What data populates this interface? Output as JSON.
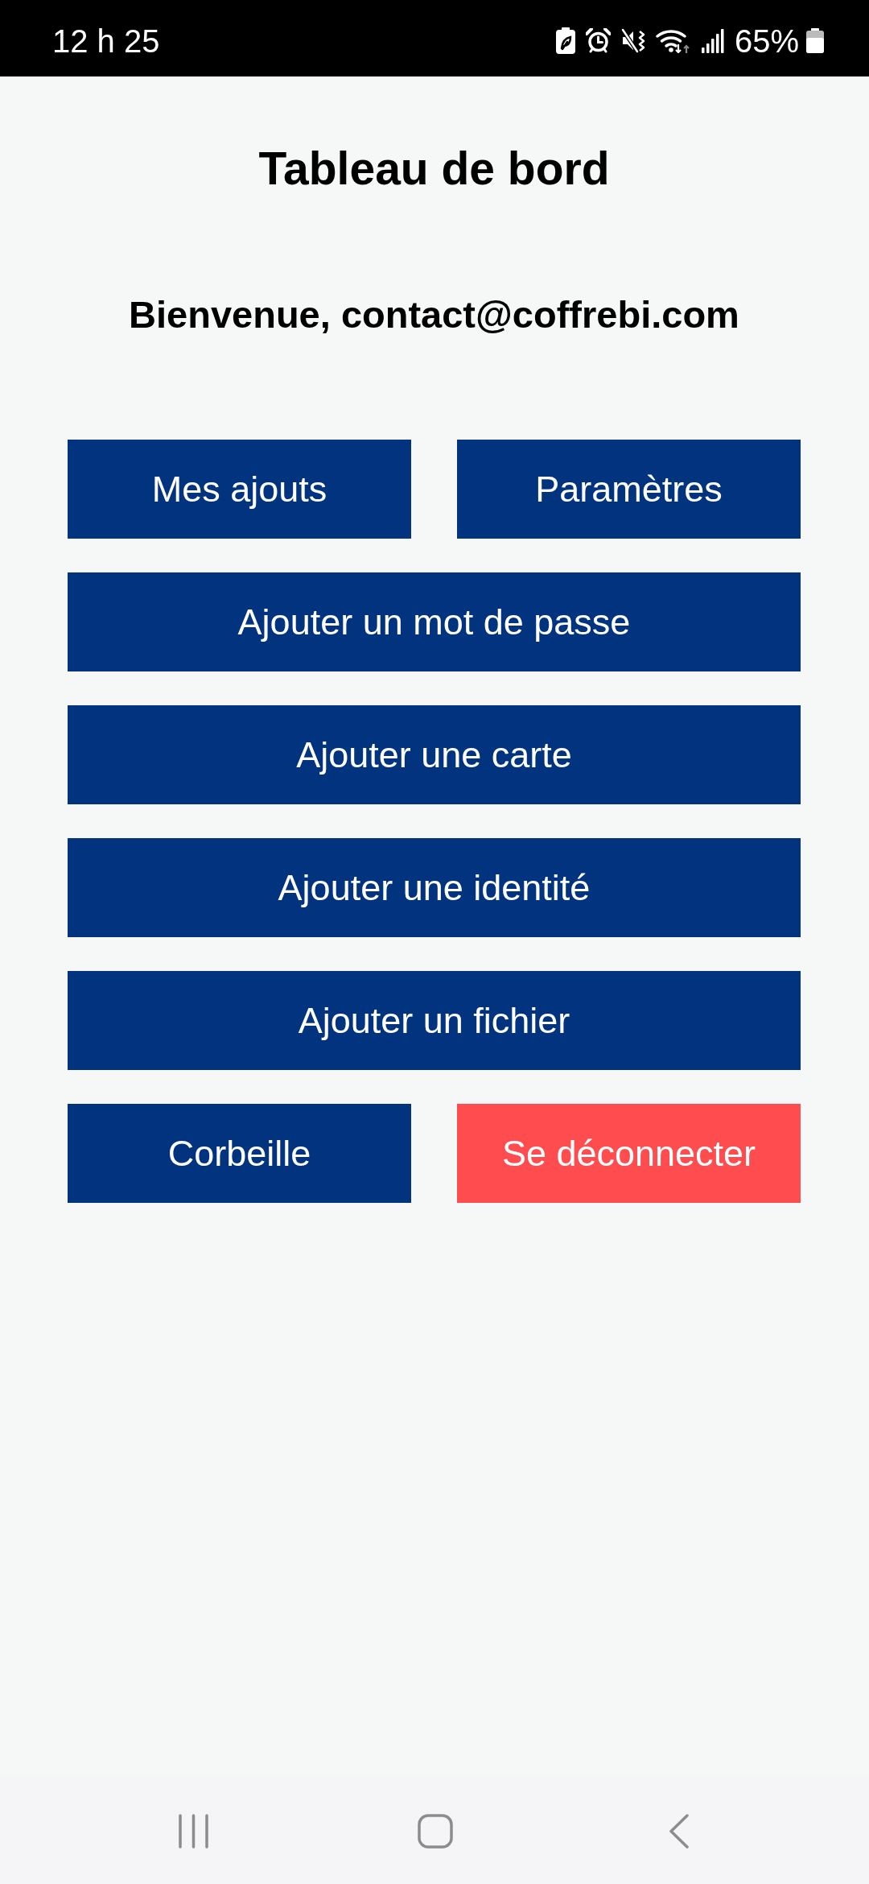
{
  "status_bar": {
    "time": "12 h 25",
    "battery": "65%"
  },
  "title": "Tableau de bord",
  "welcome": "Bienvenue, contact@coffrebi.com",
  "button_rows": [
    [
      {
        "label": "Mes ajouts",
        "kind": "primary"
      },
      {
        "label": "Paramètres",
        "kind": "primary"
      }
    ],
    [
      {
        "label": "Ajouter un mot de passe",
        "kind": "primary"
      }
    ],
    [
      {
        "label": "Ajouter une carte",
        "kind": "primary"
      }
    ],
    [
      {
        "label": "Ajouter une identité",
        "kind": "primary"
      }
    ],
    [
      {
        "label": "Ajouter un fichier",
        "kind": "primary"
      }
    ],
    [
      {
        "label": "Corbeille",
        "kind": "primary"
      },
      {
        "label": "Se déconnecter",
        "kind": "danger"
      }
    ]
  ]
}
